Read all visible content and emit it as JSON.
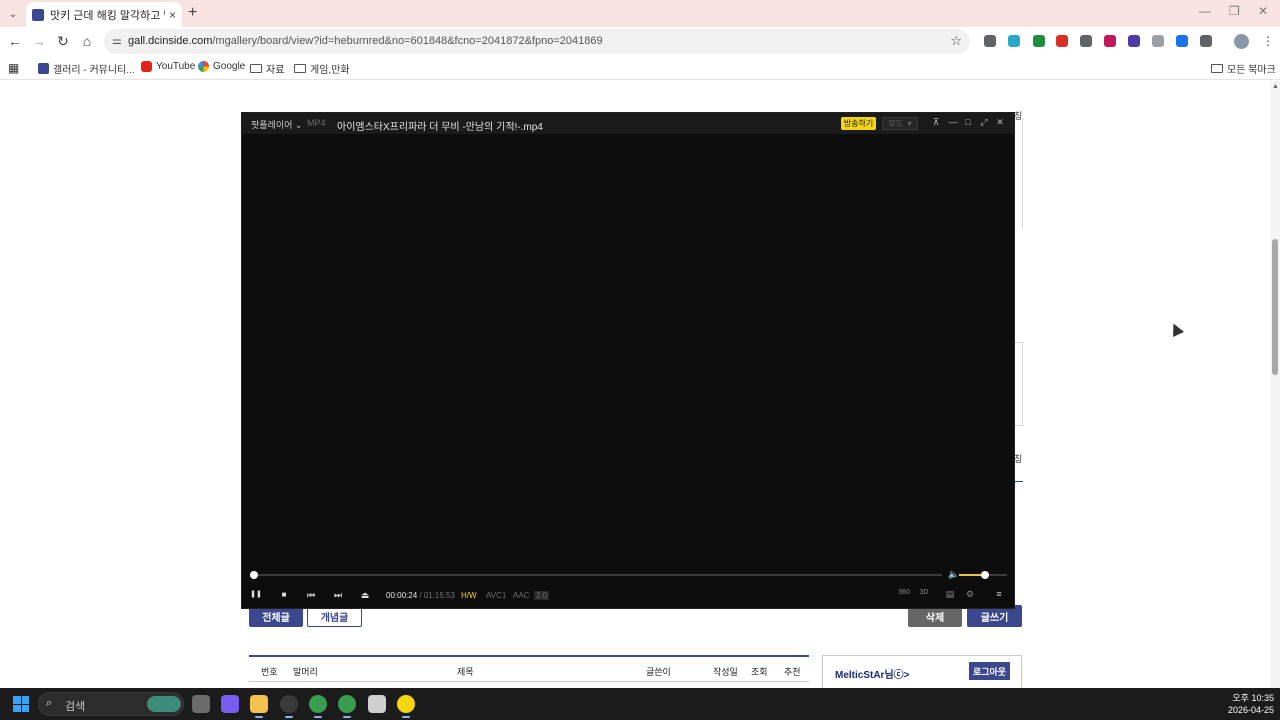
{
  "browser": {
    "tab": {
      "title": "맛키 근데 해킹 말각하고 벌트",
      "close_icon": "×"
    },
    "new_tab_icon": "+",
    "tab_search_icon": "⌄",
    "window_controls": {
      "minimize": "—",
      "restore": "❐",
      "close": "✕"
    },
    "toolbar": {
      "back_icon": "←",
      "forward_icon": "→",
      "reload_icon": "↻",
      "home_icon": "⌂",
      "site_info_icon": "⚌",
      "url_host": "gall.dcinside.com",
      "url_path": "/mgallery/board/view?id=heburnred&no=601848&fcno=2041872&fpno=2041869",
      "bookmark_star_icon": "☆",
      "menu_icon": "⋮"
    },
    "bookmarks": {
      "apps_icon": "▦",
      "items": [
        {
          "label": "갤러리 - 커뮤니티...",
          "icon": "dcinside-icon"
        },
        {
          "label": "YouTube",
          "icon": "youtube-icon"
        },
        {
          "label": "Google",
          "icon": "google-icon"
        },
        {
          "label": "자료",
          "icon": "folder-icon"
        },
        {
          "label": "게임,만화",
          "icon": "folder-icon"
        }
      ],
      "all_bookmarks": "모든 북마크"
    },
    "extension_colors": [
      "#5f6368",
      "#2aa7c9",
      "#1e8e3e",
      "#d93025",
      "#5f6368",
      "#c2185b",
      "#4b3ba3",
      "#9aa0a6",
      "#1a73e8",
      "#5f6368"
    ]
  },
  "page": {
    "buttons": {
      "all_posts": "전체글",
      "concept_posts": "개념글",
      "delete": "삭제",
      "write": "글쓰기"
    },
    "table_headers": {
      "no": "번호",
      "head": "말머리",
      "title": "제목",
      "author": "글쓴이",
      "date": "작성일",
      "views": "조회",
      "recommend": "추천"
    },
    "login": {
      "user": "MelticStAr님",
      "user_suffix": "ⓒ>",
      "logout": "로그아웃"
    },
    "side_chars": [
      "칭",
      "칭"
    ]
  },
  "player": {
    "brand": "팟플레이어",
    "brand_caret": "⌄",
    "format": "MP4",
    "file_name": "아이엠스타X프리파라 더 무비 -만남의 기적!-.mp4",
    "broadcast": "방송하기",
    "mode": "모드",
    "mode_caret": "▾",
    "window_buttons": {
      "pin": "⊼",
      "minimize": "—",
      "maximize": "□",
      "fullscreen": "⤢",
      "close": "✕"
    },
    "current_time": "00:00:24",
    "total_time": "01:15:53",
    "progress_fraction": 0.0053,
    "volume_fraction": 0.55,
    "tags": {
      "hw": "H/W",
      "video": "AVC1",
      "audio": "AAC",
      "channels": "2.0"
    },
    "controls": {
      "pause": "❚❚",
      "stop": "■",
      "prev": "⏮",
      "next": "⏭",
      "eject": "⏏",
      "volume": "🔈",
      "view360": "360",
      "view3d": "3D",
      "playlist": "▤",
      "settings": "⚙",
      "menu": "≡"
    }
  },
  "taskbar": {
    "search_icon": "⌕",
    "search_label": "검색",
    "apps": [
      {
        "name": "taskview",
        "color": "#6b6b6b",
        "active": false
      },
      {
        "name": "copilot",
        "color": "#7b5cf0",
        "active": false
      },
      {
        "name": "file-explorer",
        "color": "#f2c14e",
        "active": true
      },
      {
        "name": "app-circle",
        "color": "#3a3a3a",
        "active": true
      },
      {
        "name": "chrome",
        "color": "#3a9c4f",
        "active": true
      },
      {
        "name": "chrome-alt",
        "color": "#3a9c4f",
        "active": true
      },
      {
        "name": "line",
        "color": "#cfcfcf",
        "active": false
      },
      {
        "name": "kakaotalk",
        "color": "#f5d50c",
        "active": true
      }
    ],
    "clock_time": "오후 10:35",
    "clock_date": "2026-04-25"
  }
}
